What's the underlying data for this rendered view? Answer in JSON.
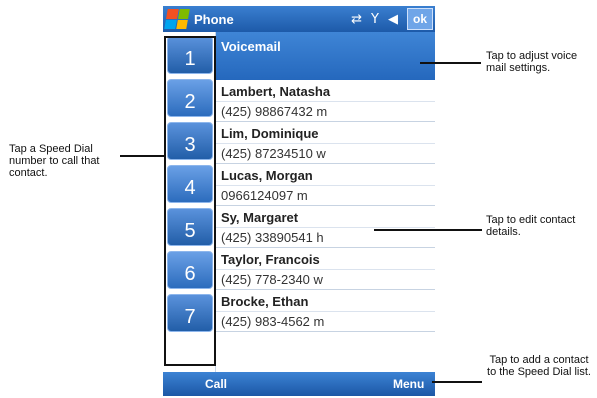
{
  "titlebar": {
    "app_title": "Phone",
    "icons": [
      "windows-start-icon",
      "connectivity-icon",
      "signal-icon",
      "speaker-icon"
    ],
    "ok_label": "ok"
  },
  "speed_dial": {
    "numbers": [
      "1",
      "2",
      "3",
      "4",
      "5",
      "6",
      "7"
    ]
  },
  "voicemail": {
    "label": "Voicemail"
  },
  "contacts": [
    {
      "name": "Lambert, Natasha",
      "number": "(425) 98867432 m"
    },
    {
      "name": "Lim, Dominique",
      "number": "(425) 87234510 w"
    },
    {
      "name": "Lucas, Morgan",
      "number": "0966124097 m"
    },
    {
      "name": "Sy, Margaret",
      "number": "(425) 33890541 h"
    },
    {
      "name": "Taylor, Francois",
      "number": "(425) 778-2340 w"
    },
    {
      "name": "Brocke, Ethan",
      "number": "(425) 983-4562 m"
    }
  ],
  "menubar": {
    "left": "Call",
    "right": "Menu"
  },
  "callouts": {
    "speed_dial": "Tap a Speed Dial number to call that contact.",
    "voicemail": "Tap to adjust voice mail settings.",
    "contact": "Tap to edit contact details.",
    "menu": "Tap to add a contact to the Speed Dial list."
  },
  "colors": {
    "title_bar": "#2b6cc0",
    "selection": "#3f85d6",
    "speed_dial_button": "#3d7ccc"
  }
}
